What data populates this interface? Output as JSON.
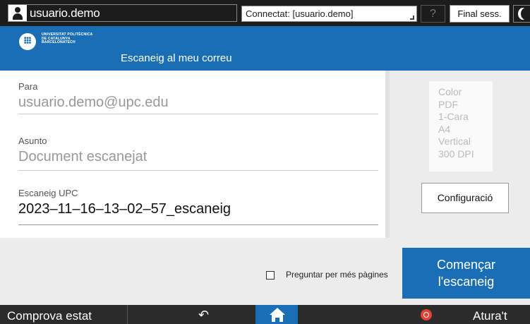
{
  "topbar": {
    "user_name": "usuario.demo",
    "connection_status": "Connectat: [usuario.demo]",
    "help_label": "?",
    "logout_label": "Final sess."
  },
  "header": {
    "logo_lines": [
      "UNIVERSITAT POLITÈCNICA",
      "DE CATALUNYA",
      "BARCELONATECH"
    ],
    "title": "Escaneig al meu correu"
  },
  "form": {
    "to": {
      "label": "Para",
      "value": "usuario.demo@upc.edu"
    },
    "subject": {
      "label": "Asunto",
      "placeholder": "Document escanejat"
    },
    "filename": {
      "label": "Escaneig UPC",
      "value": "2023–11–16–13–02–57_escaneig"
    }
  },
  "settings": {
    "summary": [
      "Color",
      "PDF",
      "1-Cara",
      "A4",
      "Vertical",
      "300 DPI"
    ],
    "config_label": "Configuració"
  },
  "actions": {
    "more_pages_label": "Preguntar per més pàgines",
    "more_pages_checked": false,
    "start_line1": "Començar",
    "start_line2": "l'escaneig"
  },
  "footer": {
    "status_label": "Comprova estat",
    "stop_label": "Atura't"
  }
}
